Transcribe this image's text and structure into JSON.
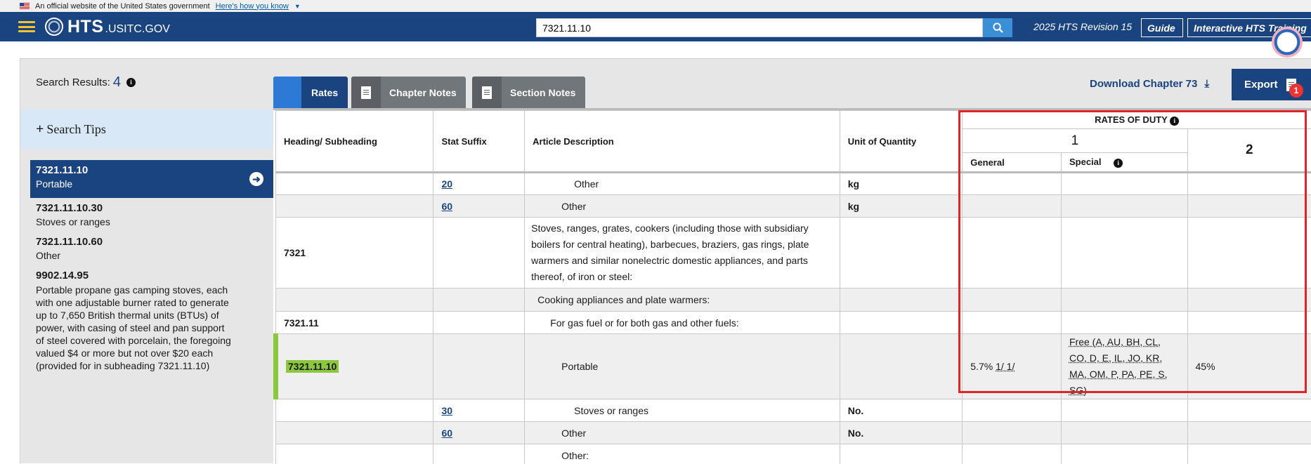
{
  "gov_banner": {
    "text": "An official website of the United States government",
    "link": "Here's how you know"
  },
  "header": {
    "logo_main": "HTS",
    "logo_sub": ".USITC.GOV",
    "search_value": "7321.11.10",
    "revision": "2025 HTS Revision 15",
    "guide": "Guide",
    "training": "Interactive HTS Training"
  },
  "results": {
    "label": "Search Results:",
    "count": "4"
  },
  "search_tips": "Search Tips",
  "sidebar": {
    "items": [
      {
        "code": "7321.11.10",
        "desc": "Portable"
      },
      {
        "code": "7321.11.10.30",
        "desc": "Stoves or ranges"
      },
      {
        "code": "7321.11.10.60",
        "desc": "Other"
      },
      {
        "code": "9902.14.95",
        "desc": "Portable propane gas camping stoves, each with one adjustable burner rated to generate up to 7,650 British thermal units (BTUs) of power, with casing of steel and pan support of steel covered with porcelain, the foregoing valued $4 or more but not over $20 each (provided for in subheading 7321.11.10)"
      }
    ]
  },
  "tabs": {
    "rates": "Rates",
    "chapter_notes": "Chapter Notes",
    "section_notes": "Section Notes"
  },
  "download": "Download Chapter 73",
  "export": "Export",
  "badge_count": "1",
  "table": {
    "headers": {
      "heading": "Heading/ Subheading",
      "stat": "Stat Suffix",
      "desc": "Article Description",
      "unit": "Unit of Quantity",
      "rates": "RATES OF DUTY",
      "col1": "1",
      "general": "General",
      "special": "Special",
      "col2": "2"
    },
    "rows": [
      {
        "heading": "",
        "stat": "20",
        "desc": "Other",
        "unit": "kg",
        "general": "",
        "special": "",
        "col2": ""
      },
      {
        "heading": "",
        "stat": "60",
        "desc": "Other",
        "unit": "kg",
        "general": "",
        "special": "",
        "col2": ""
      },
      {
        "heading": "7321",
        "stat": "",
        "desc": "Stoves, ranges, grates, cookers (including those with subsidiary boilers for central heating), barbecues, braziers, gas rings, plate warmers and similar nonelectric domestic appliances, and parts thereof, of iron or steel:",
        "unit": "",
        "general": "",
        "special": "",
        "col2": ""
      },
      {
        "heading": "",
        "stat": "",
        "desc": "Cooking appliances and plate warmers:",
        "unit": "",
        "general": "",
        "special": "",
        "col2": ""
      },
      {
        "heading": "7321.11",
        "stat": "",
        "desc": "For gas fuel or for both gas and other fuels:",
        "unit": "",
        "general": "",
        "special": "",
        "col2": ""
      },
      {
        "heading": "7321.11.10",
        "stat": "",
        "desc": "Portable",
        "unit": "",
        "general": "5.7%",
        "general_fn": "1/ 1/",
        "special": "Free (A, AU, BH, CL, CO, D, E, IL, JO, KR, MA, OM, P, PA, PE, S, SG)",
        "col2": "45%"
      },
      {
        "heading": "",
        "stat": "30",
        "desc": "Stoves or ranges",
        "unit": "No.",
        "general": "",
        "special": "",
        "col2": ""
      },
      {
        "heading": "",
        "stat": "60",
        "desc": "Other",
        "unit": "No.",
        "general": "",
        "special": "",
        "col2": ""
      },
      {
        "heading": "",
        "stat": "",
        "desc": "Other:",
        "unit": "",
        "general": "",
        "special": "",
        "col2": ""
      }
    ]
  }
}
